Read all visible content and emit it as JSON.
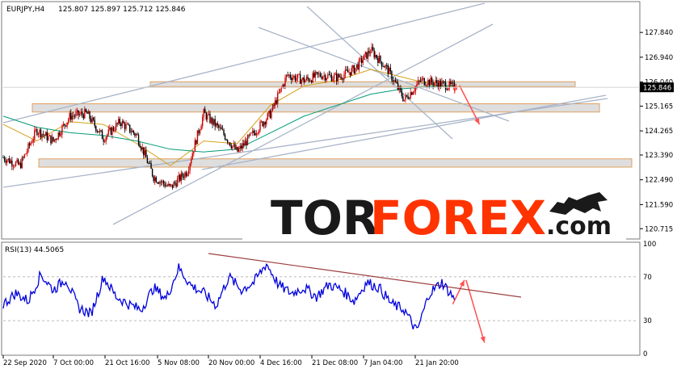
{
  "chart_data": [
    {
      "type": "candlestick",
      "title": "EURJPY,H4  125.807 125.897 125.712 125.846",
      "symbol_label": "EURJPY,H4",
      "ohlc_label": "125.807 125.897 125.712 125.846",
      "ylim": [
        120.4,
        128.9
      ],
      "y_ticks": [
        "127.840",
        "126.940",
        "126.040",
        "125.165",
        "124.265",
        "123.390",
        "122.490",
        "121.590",
        "120.715"
      ],
      "current_price_label": "125.846",
      "current_price": 125.846,
      "series": [
        {
          "name": "",
          "color": "#cc0000",
          "x": [
            0,
            20,
            40,
            60,
            80,
            100,
            120,
            140,
            160,
            180,
            200,
            220,
            240,
            260,
            280,
            300,
            320,
            340,
            360,
            380,
            400,
            420,
            440,
            460,
            480,
            500,
            520,
            540
          ],
          "values": [
            123.3,
            123.0,
            124.3,
            123.9,
            124.8,
            124.9,
            124.0,
            124.6,
            124.1,
            122.6,
            122.2,
            122.8,
            124.9,
            124.3,
            123.5,
            124.2,
            124.9,
            126.3,
            126.1,
            126.3,
            126.2,
            126.5,
            127.2,
            126.5,
            125.4,
            126.1,
            126.0,
            125.85
          ]
        },
        {
          "name": "",
          "color": "#d4a017",
          "x": [
            0,
            40,
            80,
            120,
            160,
            200,
            240,
            280,
            320,
            360,
            400,
            440,
            480,
            520,
            540
          ],
          "values": [
            124.5,
            123.9,
            124.6,
            124.5,
            123.8,
            123.0,
            123.9,
            123.8,
            125.2,
            125.9,
            126.1,
            126.5,
            126.2,
            125.9,
            125.9
          ]
        },
        {
          "name": "",
          "color": "#009b77",
          "x": [
            0,
            40,
            80,
            120,
            160,
            200,
            240,
            280,
            320,
            360,
            400,
            440,
            480,
            520,
            540
          ],
          "values": [
            124.8,
            124.4,
            124.2,
            124.1,
            123.9,
            123.6,
            123.5,
            123.6,
            124.2,
            124.8,
            125.2,
            125.6,
            125.8,
            125.9,
            125.9
          ]
        }
      ],
      "zones": [
        {
          "from": 125.9,
          "to": 126.05
        },
        {
          "from": 124.95,
          "to": 125.25
        },
        {
          "from": 122.95,
          "to": 123.25
        }
      ],
      "forecast_arrow": {
        "from": 125.8,
        "to": 124.5
      }
    },
    {
      "type": "line",
      "title": "RSI(13) 44.5065",
      "ylim": [
        0,
        100
      ],
      "y_ticks": [
        "100",
        "70",
        "30",
        "0"
      ],
      "levels": [
        70,
        30
      ],
      "series": [
        {
          "name": "",
          "color": "#0000dd",
          "x": [
            0,
            15,
            30,
            45,
            60,
            75,
            90,
            105,
            120,
            135,
            150,
            165,
            180,
            195,
            210,
            225,
            240,
            255,
            270,
            285,
            300,
            315,
            330,
            345,
            360,
            375,
            390,
            405,
            420,
            435,
            450,
            465,
            480,
            495,
            510,
            525,
            540
          ],
          "values": [
            45,
            55,
            48,
            72,
            58,
            68,
            42,
            36,
            70,
            52,
            45,
            40,
            60,
            50,
            78,
            62,
            55,
            44,
            70,
            58,
            65,
            82,
            62,
            55,
            60,
            52,
            63,
            58,
            48,
            65,
            60,
            45,
            40,
            20,
            55,
            65,
            50
          ]
        }
      ],
      "forecast_arrow": {
        "from": 67,
        "to": 10
      }
    }
  ],
  "x_axis": {
    "tick_labels": [
      "22 Sep 2020",
      "7 Oct 00:00",
      "21 Oct 16:00",
      "5 Nov 08:00",
      "20 Nov 00:00",
      "4 Dec 16:00",
      "21 Dec 08:00",
      "7 Jan 04:00",
      "21 Jan 20:00"
    ]
  },
  "watermark": {
    "part1": "TOR",
    "part2": "FOREX",
    "suffix": ".com",
    "colors": {
      "dark": "#1a1a1a",
      "accent": "#ff3300"
    }
  },
  "colors": {
    "bull_candle": "#cc0000",
    "bear_candle": "#000000",
    "ma_orange": "#d4a017",
    "ma_teal": "#009b77",
    "trendlines": "#a8b4c8",
    "zone_fill": "#d8d8d8",
    "zone_border": "#e0a060",
    "arrow": "#ff5050",
    "rsi_line": "#0000dd",
    "rsi_trend": "#a04040",
    "price_label_bg": "#000000"
  }
}
